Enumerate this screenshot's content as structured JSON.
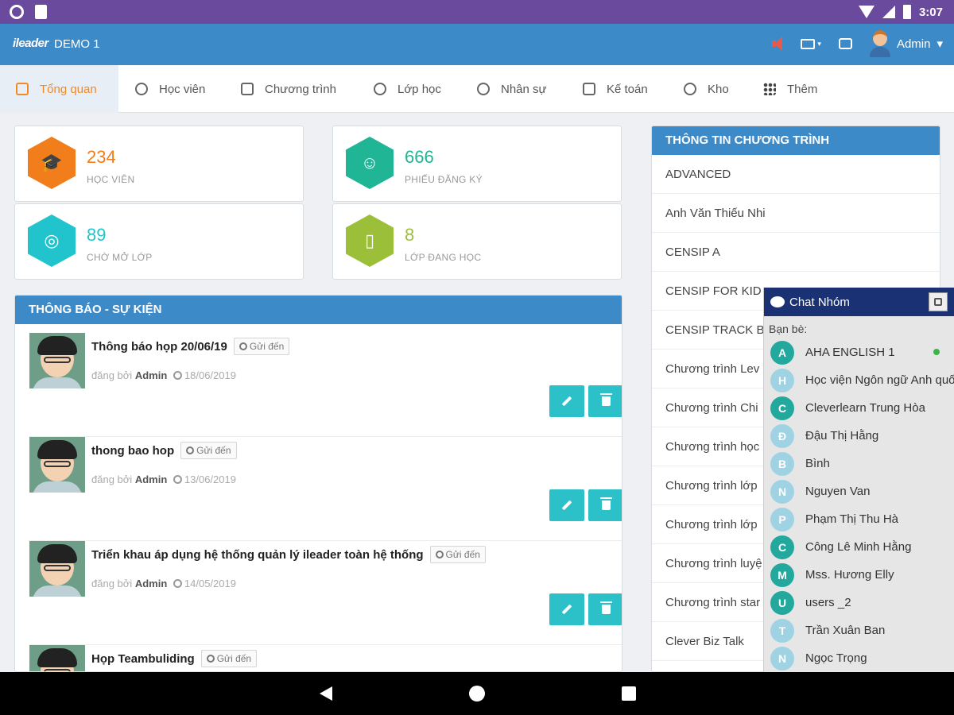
{
  "status_bar": {
    "time": "3:07"
  },
  "app": {
    "logo": "ileader",
    "name": "DEMO 1",
    "user": "Admin"
  },
  "nav": [
    {
      "label": "Tổng quan",
      "icon": "home-icon"
    },
    {
      "label": "Học viên",
      "icon": "user-icon"
    },
    {
      "label": "Chương trình",
      "icon": "graduation-cap-icon"
    },
    {
      "label": "Lớp học",
      "icon": "class-icon"
    },
    {
      "label": "Nhân sự",
      "icon": "staff-icon"
    },
    {
      "label": "Kế toán",
      "icon": "calculator-icon"
    },
    {
      "label": "Kho",
      "icon": "inventory-icon"
    },
    {
      "label": "Thêm",
      "icon": "grid-icon"
    }
  ],
  "stats": [
    {
      "value": "234",
      "label": "HỌC VIÊN",
      "color": "#f17e1a",
      "icon": "graduation-cap-icon"
    },
    {
      "value": "666",
      "label": "PHIẾU ĐĂNG KÝ",
      "color": "#20b594",
      "icon": "users-icon"
    },
    {
      "value": "89",
      "label": "CHỜ MỞ LỚP",
      "color": "#21c4cc",
      "icon": "palette-icon"
    },
    {
      "value": "8",
      "label": "LỚP ĐANG HỌC",
      "color": "#9cbf3a",
      "icon": "book-icon"
    }
  ],
  "announcements": {
    "title": "THÔNG BÁO - SỰ KIỆN",
    "send_label": "Gửi đến",
    "posted_by": "đăng bởi",
    "items": [
      {
        "title": "Thông báo họp 20/06/19",
        "author": "Admin",
        "date": "18/06/2019"
      },
      {
        "title": "thong bao hop",
        "author": "Admin",
        "date": "13/06/2019"
      },
      {
        "title": "Triển khau áp dụng hệ thống quản lý ileader toàn hệ thống",
        "author": "Admin",
        "date": "14/05/2019"
      },
      {
        "title": "Họp Teambuliding",
        "author": "",
        "date": ""
      }
    ]
  },
  "programs": {
    "title": "THÔNG TIN CHƯƠNG TRÌNH",
    "items": [
      "ADVANCED",
      "Anh Văn Thiếu Nhi",
      "CENSIP A",
      "CENSIP FOR KID",
      "CENSIP TRACK B",
      "Chương trình Lev",
      "Chương trình Chi",
      "Chương trình học",
      "Chương trình lớp",
      "Chương trình lớp",
      "Chương trình luyệ",
      "Chương trình star",
      "Clever Biz Talk"
    ]
  },
  "chat": {
    "title": "Chat Nhóm",
    "friends_label": "Bạn bè:",
    "friends": [
      {
        "initial": "A",
        "name": "AHA ENGLISH 1",
        "color": "#23a89d",
        "online": true
      },
      {
        "initial": "H",
        "name": "Học viện Ngôn ngữ Anh quốc ABIT",
        "color": "#9fd3e3",
        "online": false
      },
      {
        "initial": "C",
        "name": "Cleverlearn Trung Hòa",
        "color": "#23a89d",
        "online": false
      },
      {
        "initial": "Đ",
        "name": "Đậu Thị Hằng",
        "color": "#9fd3e3",
        "online": false
      },
      {
        "initial": "B",
        "name": "Bình",
        "color": "#9fd3e3",
        "online": false
      },
      {
        "initial": "N",
        "name": "Nguyen Van",
        "color": "#9fd3e3",
        "online": false
      },
      {
        "initial": "P",
        "name": "Phạm Thị Thu Hà",
        "color": "#9fd3e3",
        "online": false
      },
      {
        "initial": "C",
        "name": "Công Lê Minh Hằng",
        "color": "#23a89d",
        "online": false
      },
      {
        "initial": "M",
        "name": "Mss. Hương Elly",
        "color": "#23a89d",
        "online": false
      },
      {
        "initial": "U",
        "name": "users _2",
        "color": "#23a89d",
        "online": false
      },
      {
        "initial": "T",
        "name": "Trần Xuân Ban",
        "color": "#9fd3e3",
        "online": false
      },
      {
        "initial": "N",
        "name": "Ngọc Trọng",
        "color": "#9fd3e3",
        "online": false
      }
    ]
  }
}
